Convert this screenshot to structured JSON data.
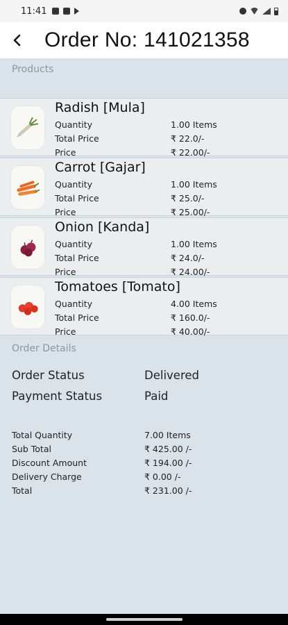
{
  "status_bar": {
    "time": "11:41",
    "left_icons": [
      "notification-icon",
      "gallery-icon",
      "play-icon"
    ],
    "right_icons": [
      "alarm-icon",
      "wifi-icon",
      "signal-icon",
      "battery-icon"
    ]
  },
  "header": {
    "title": "Order No: 141021358",
    "back_icon": "chevron-left-icon"
  },
  "products_section": {
    "label": "Products",
    "labels": {
      "quantity": "Quantity",
      "total_price": "Total Price",
      "price": "Price"
    },
    "items": [
      {
        "name": "Radish [Mula]",
        "quantity": "1.00 Items",
        "total_price": "₹ 22.0/-",
        "price": "₹ 22.00/-",
        "image": "radish-image"
      },
      {
        "name": "Carrot [Gajar]",
        "quantity": "1.00 Items",
        "total_price": "₹ 25.0/-",
        "price": "₹ 25.00/-",
        "image": "carrot-image"
      },
      {
        "name": "Onion [Kanda]",
        "quantity": "1.00 Items",
        "total_price": "₹ 24.0/-",
        "price": "₹ 24.00/-",
        "image": "onion-image"
      },
      {
        "name": "Tomatoes [Tomato]",
        "quantity": "4.00 Items",
        "total_price": "₹ 160.0/-",
        "price": "₹ 40.00/-",
        "image": "tomato-image"
      }
    ]
  },
  "order_details": {
    "label": "Order Details",
    "order_status_label": "Order Status",
    "order_status_value": "Delivered",
    "payment_status_label": "Payment Status",
    "payment_status_value": "Paid",
    "totals": [
      {
        "label": "Total Quantity",
        "value": " 7.00 Items"
      },
      {
        "label": "Sub Total",
        "value": "₹ 425.00 /-"
      },
      {
        "label": "Discount Amount",
        "value": "₹ 194.00 /-"
      },
      {
        "label": "Delivery Charge",
        "value": "₹ 0.00 /-"
      },
      {
        "label": "Total",
        "value": "₹ 231.00 /-"
      }
    ]
  },
  "colors": {
    "background": "#dbe3ea",
    "card": "#ebeeef",
    "section_label": "#8b97a3"
  }
}
